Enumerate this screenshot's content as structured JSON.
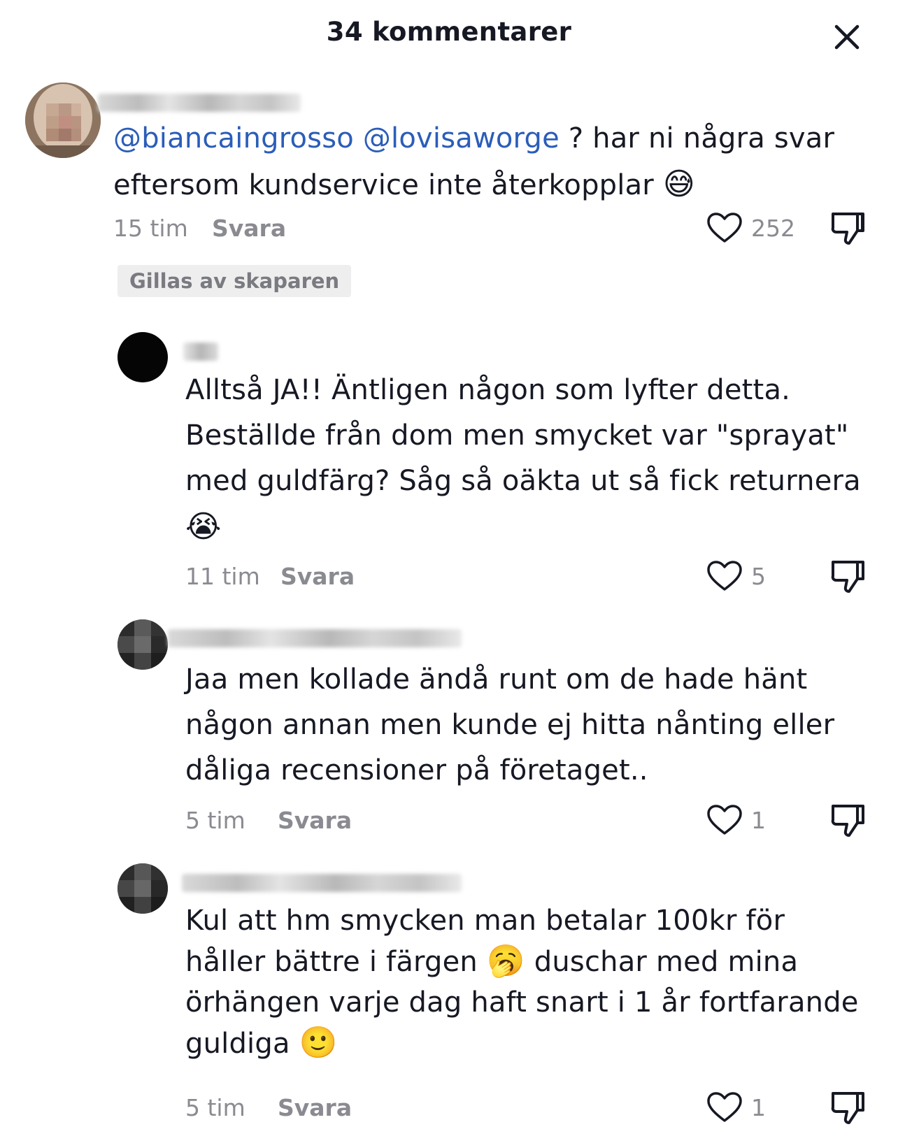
{
  "header": {
    "title": "34 kommentarer",
    "close_icon": "close-icon"
  },
  "comments": [
    {
      "mention1": "@biancaingrosso",
      "mention2": "@lovisaworge",
      "text": " ? har ni några svar eftersom kundservice inte återkopplar ",
      "emoji": "😅",
      "time": "15 tim",
      "reply_label": "Svara",
      "likes": "252",
      "badge": "Gillas av skaparen"
    },
    {
      "text": "Alltså JA!! Äntligen någon som lyfter detta. Beställde från dom men smycket var \"sprayat\" med guldfärg? Såg så oäkta ut så fick returnera",
      "emoji": "😭",
      "time": "11 tim",
      "reply_label": "Svara",
      "likes": "5"
    },
    {
      "text": "Jaa men kollade ändå runt om de hade hänt någon annan men kunde ej hitta nånting eller dåliga recensioner på företaget..",
      "time": "5 tim",
      "reply_label": "Svara",
      "likes": "1"
    },
    {
      "text_line1": "Kul att hm smycken man betalar 100kr för",
      "text_line2a": "håller bättre i färgen ",
      "emoji1": "🥱",
      "text_line2b": " duschar med mina",
      "text_line3": "örhängen varje dag haft snart i 1 år fortfarande",
      "text_line4": "guldiga ",
      "emoji2": "🙂",
      "time": "5 tim",
      "reply_label": "Svara",
      "likes": "1"
    }
  ],
  "icons": {
    "like": "heart-outline-icon",
    "dislike": "thumbs-down-icon"
  },
  "colors": {
    "mention": "#2b5db9",
    "secondary_text": "#8a8b91",
    "badge_bg": "#eeeeef"
  }
}
